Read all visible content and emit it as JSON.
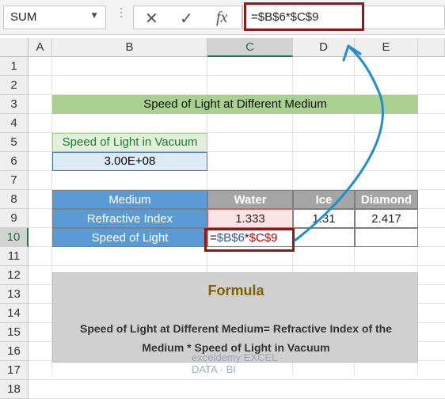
{
  "formula_bar": {
    "name_box": "SUM",
    "cancel_icon": "cancel-x-icon",
    "enter_icon": "checkmark-icon",
    "fx_label": "fx",
    "formula": "=$B$6*$C$9"
  },
  "columns": [
    "A",
    "B",
    "C",
    "D",
    "E"
  ],
  "selected_column": "C",
  "rows": [
    "1",
    "2",
    "3",
    "4",
    "5",
    "6",
    "7",
    "8",
    "9",
    "10",
    "11",
    "12",
    "13",
    "14",
    "15",
    "16",
    "17",
    "18"
  ],
  "selected_row": "10",
  "sheet": {
    "title": "Speed of Light at Different Medium",
    "vacuum_label": "Speed of Light in Vacuum",
    "vacuum_value": "3.00E+08",
    "table": {
      "header_first": "Medium",
      "media": [
        "Water",
        "Ice",
        "Diamond"
      ],
      "row1_label": "Refractive Index",
      "row1_values": [
        "1.333",
        "1.31",
        "2.417"
      ],
      "row2_label": "Speed of Light",
      "edit_eq": "=",
      "edit_ref1": "$B$6",
      "edit_op": "*",
      "edit_ref2": "$C$9"
    },
    "formula_box": {
      "heading": "Formula",
      "text": "Speed of Light at Different Medium= Refractive Index of the Medium * Speed of Light in Vacuum"
    }
  },
  "watermark": "exceldemy EXCEL · DATA · BI",
  "colors": {
    "title_green": "#a9d08e",
    "table_header_blue": "#5b9bd5",
    "table_header_grey": "#a5a5a5",
    "highlight_red": "#8b1a1a",
    "formula_heading": "#806000"
  }
}
